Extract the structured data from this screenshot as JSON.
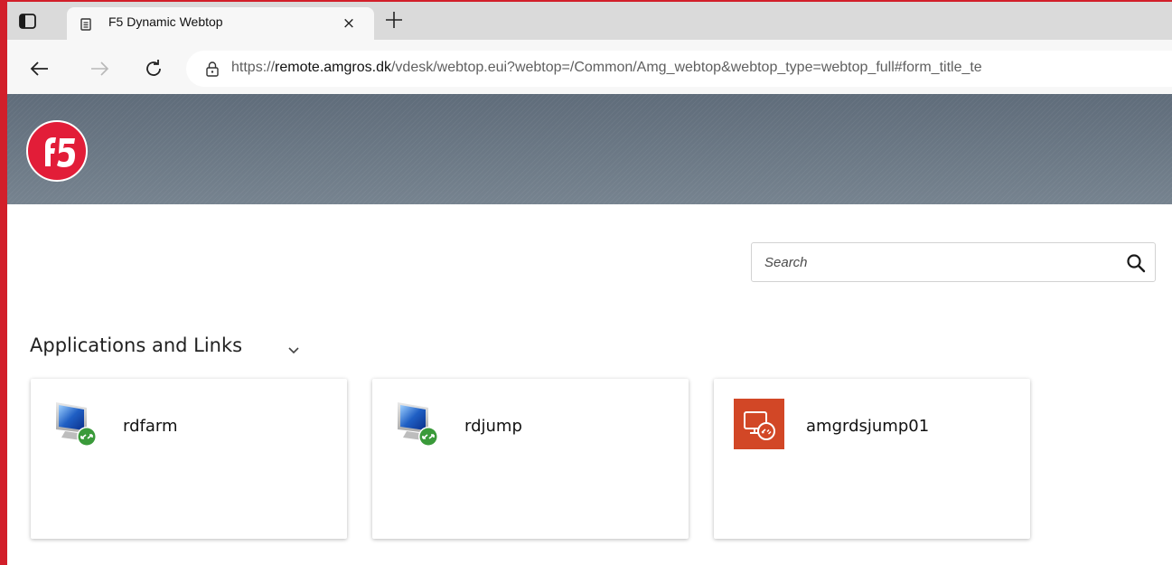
{
  "browser": {
    "tab_title": "F5 Dynamic Webtop",
    "close_symbol": "×",
    "url_scheme": "https://",
    "url_host": "remote.amgros.dk",
    "url_path": "/vdesk/webtop.eui?webtop=/Common/Amg_webtop&webtop_type=webtop_full#form_title_te"
  },
  "banner": {
    "logo_icon": "f5-logo-icon",
    "background": "#6c7a88"
  },
  "search": {
    "placeholder": "Search",
    "value": ""
  },
  "applications": {
    "title": "Applications and Links",
    "items": [
      {
        "label": "rdfarm",
        "icon": "remote-desktop-monitor-icon"
      },
      {
        "label": "rdjump",
        "icon": "remote-desktop-monitor-icon"
      },
      {
        "label": "amgrdsjump01",
        "icon": "remote-desktop-app-icon"
      }
    ]
  },
  "colors": {
    "window_edge": "#d21f2a",
    "f5_red": "#e21d38",
    "rdp_orange": "#d24726"
  }
}
